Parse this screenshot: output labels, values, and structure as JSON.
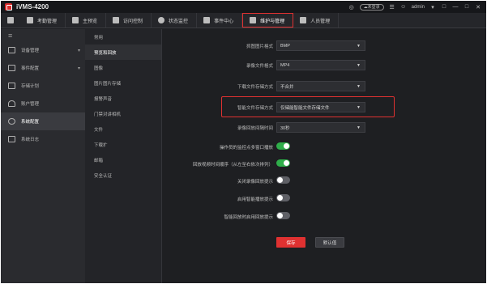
{
  "app": {
    "title": "iVMS-4200"
  },
  "titlebar": {
    "user_status": "未登录",
    "username": "admin",
    "icons": [
      "bell-icon",
      "cloud-icon",
      "list-icon",
      "user-icon",
      "lock-icon",
      "minimize-icon",
      "maximize-icon",
      "close-icon"
    ]
  },
  "tabs": [
    {
      "label": "考勤管理",
      "icon": "clock-icon"
    },
    {
      "label": "主预览",
      "icon": "monitor-icon"
    },
    {
      "label": "访问控制",
      "icon": "door-icon"
    },
    {
      "label": "状态监控",
      "icon": "globe-icon"
    },
    {
      "label": "事件中心",
      "icon": "bell-icon"
    },
    {
      "label": "维护与管理",
      "icon": "wrench-icon",
      "active": true
    },
    {
      "label": "人员管理",
      "icon": "people-icon"
    }
  ],
  "sidebar": {
    "items": [
      {
        "label": "设备管理",
        "icon": "device-icon",
        "has_caret": true
      },
      {
        "label": "事件配置",
        "icon": "event-config-icon",
        "has_caret": true
      },
      {
        "label": "存储计划",
        "icon": "storage-icon"
      },
      {
        "label": "账户管理",
        "icon": "account-icon"
      },
      {
        "label": "系统配置",
        "icon": "gear-icon",
        "active": true
      },
      {
        "label": "系统日志",
        "icon": "log-icon"
      }
    ]
  },
  "subnav": {
    "items": [
      {
        "label": "常用"
      },
      {
        "label": "预览和回放",
        "active": true
      },
      {
        "label": "图像"
      },
      {
        "label": "图片图片存储"
      },
      {
        "label": "报警声音"
      },
      {
        "label": "门禁对讲相机"
      },
      {
        "label": "文件"
      },
      {
        "label": "下载扩"
      },
      {
        "label": "邮箱"
      },
      {
        "label": "安全认证"
      }
    ]
  },
  "form": {
    "fields": [
      {
        "label": "抓图图片格式",
        "value": "BMP"
      },
      {
        "label": "录像文件格式",
        "value": "MP4"
      },
      {
        "label": "下载文件存储方式",
        "value": "不合并"
      },
      {
        "label": "智能文件存储方式",
        "value": "仅储能智能文件存储文件",
        "highlighted": true
      },
      {
        "label": "录像回放间隔时间",
        "value": "30秒"
      }
    ],
    "toggles": [
      {
        "label": "操作员的监控点多窗口播放",
        "on": true
      },
      {
        "label": "回放视频时间顺序（从左至右依次排列）",
        "on": true
      },
      {
        "label": "关闭录像回放提示",
        "on": false
      },
      {
        "label": "启用智能播放提示",
        "on": false
      },
      {
        "label": "智能回放时启用回放提示",
        "on": false
      }
    ],
    "save_label": "保存",
    "restore_label": "默认值"
  },
  "colors": {
    "accent": "#e03131",
    "toggle_on": "#2fae4a",
    "background": "#1e1f22"
  }
}
